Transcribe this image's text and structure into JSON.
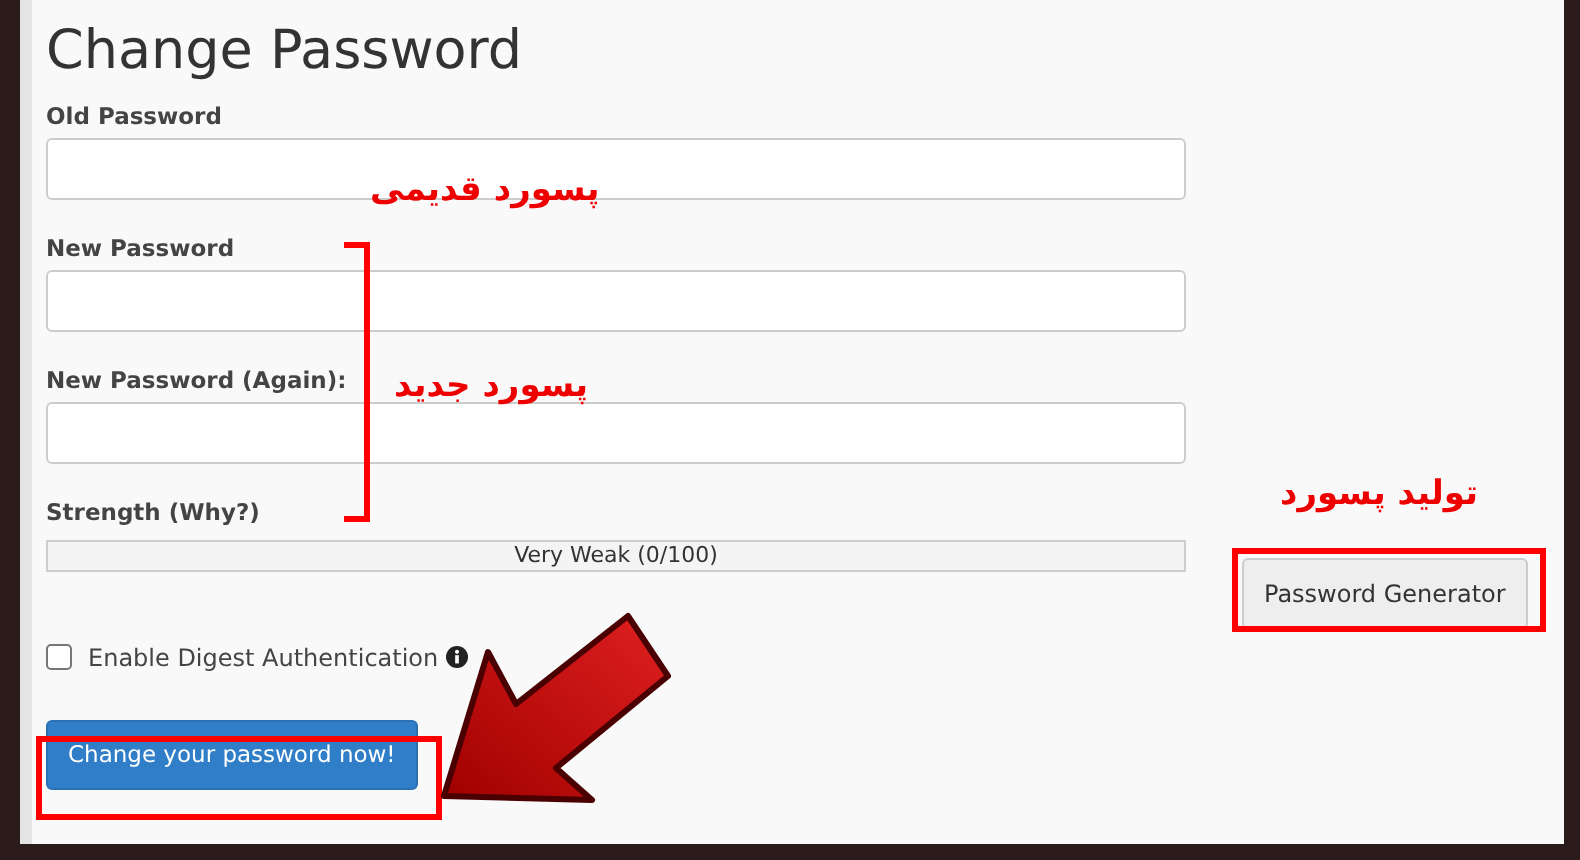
{
  "title": "Change Password",
  "fields": [
    {
      "label": "Old Password"
    },
    {
      "label": "New Password"
    },
    {
      "label": "New Password (Again):"
    }
  ],
  "strength": {
    "label": "Strength (Why?)",
    "level": 0,
    "reading": "Very Weak (0/100)"
  },
  "generator_button": "Password Generator",
  "digest": {
    "label": "Enable Digest Authentication",
    "checked": false
  },
  "submit_button": "Change your password now!",
  "annotations": [
    {
      "kind": "note",
      "text": "پسورد قدیمی"
    },
    {
      "kind": "note",
      "text": "پسورد جدید"
    },
    {
      "kind": "note",
      "text": "تولید پسورد"
    },
    {
      "kind": "bracket"
    },
    {
      "kind": "arrow"
    }
  ]
}
